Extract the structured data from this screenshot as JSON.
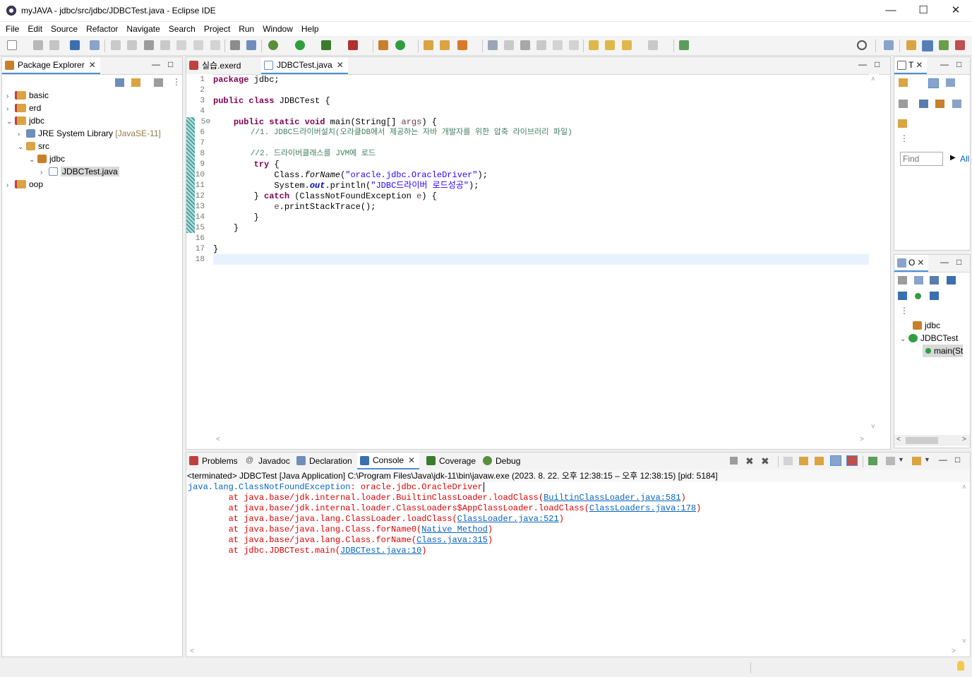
{
  "window": {
    "title": "myJAVA - jdbc/src/jdbc/JDBCTest.java - Eclipse IDE"
  },
  "menu": [
    "File",
    "Edit",
    "Source",
    "Refactor",
    "Navigate",
    "Search",
    "Project",
    "Run",
    "Window",
    "Help"
  ],
  "package_explorer": {
    "tab_label": "Package Explorer",
    "items": [
      {
        "label": "basic",
        "arrow": "›",
        "indent": 0
      },
      {
        "label": "erd",
        "arrow": "›",
        "indent": 0
      },
      {
        "label": "jdbc",
        "arrow": "⌄",
        "indent": 0
      },
      {
        "label": "JRE System Library",
        "suffix": "[JavaSE-11]",
        "arrow": "›",
        "indent": 1
      },
      {
        "label": "src",
        "arrow": "⌄",
        "indent": 1
      },
      {
        "label": "jdbc",
        "arrow": "⌄",
        "indent": 2
      },
      {
        "label": "JDBCTest.java",
        "arrow": "›",
        "indent": 3
      },
      {
        "label": "oop",
        "arrow": "›",
        "indent": 0
      }
    ]
  },
  "editor": {
    "tabs": [
      {
        "label": "실습.exerd",
        "active": false
      },
      {
        "label": "JDBCTest.java",
        "active": true
      }
    ],
    "line_numbers": [
      "1",
      "2",
      "3",
      "4",
      "5⊖",
      "6",
      "7",
      "8",
      "9",
      "10",
      "11",
      "12",
      "13",
      "14",
      "15",
      "16",
      "17",
      "18"
    ]
  },
  "code": {
    "l1_kw": "package",
    "l1_rest": " jdbc;",
    "l3_kw1": "public",
    "l3_kw2": "class",
    "l3_rest": " JDBCTest {",
    "l5_kw1": "public",
    "l5_kw2": "static",
    "l5_kw3": "void",
    "l5_rest": " main(String[] ",
    "l5_var": "args",
    "l5_end": ") {",
    "l6": "//1. JDBC드라이버설치(오라클DB에서 제공하는 자바 개발자를 위한 압축 라이브러리 파일)",
    "l8": "//2. 드라이버클래스를 JVM에 로드",
    "l9_kw": "try",
    "l9_rest": " {",
    "l10_a": "Class.",
    "l10_b": "forName",
    "l10_c": "(",
    "l10_str": "\"oracle.jdbc.OracleDriver\"",
    "l10_end": ");",
    "l11_a": "System.",
    "l11_b": "out",
    "l11_c": ".println(",
    "l11_str": "\"JDBC드라이버 로드성공\"",
    "l11_end": ");",
    "l12_a": "} ",
    "l12_kw": "catch",
    "l12_b": " (ClassNotFoundException ",
    "l12_var": "e",
    "l12_end": ") {",
    "l13_var": "e",
    "l13_rest": ".printStackTrace();",
    "l14": "}",
    "l15": "}",
    "l17": "}"
  },
  "task_panel": {
    "tab_label": "T",
    "find_placeholder": "Find",
    "all_label": "All"
  },
  "outline": {
    "tab_label": "O",
    "items": [
      {
        "label": "jdbc"
      },
      {
        "label": "JDBCTest"
      },
      {
        "label": "main(St"
      }
    ]
  },
  "bottom": {
    "tabs": [
      {
        "label": "Problems"
      },
      {
        "label": "Javadoc"
      },
      {
        "label": "Declaration"
      },
      {
        "label": "Console",
        "active": true
      },
      {
        "label": "Coverage"
      },
      {
        "label": "Debug"
      }
    ],
    "status": "<terminated> JDBCTest [Java Application] C:\\Program Files\\Java\\jdk-11\\bin\\javaw.exe  (2023. 8. 22. 오후 12:38:15 – 오후 12:38:15) [pid: 5184]",
    "exception_class": "java.lang.ClassNotFoundException",
    "exception_msg": ": oracle.jdbc.OracleDriver",
    "stack": [
      {
        "pre": "\tat java.base/jdk.internal.loader.BuiltinClassLoader.loadClass(",
        "link": "BuiltinClassLoader.java:581",
        "post": ")"
      },
      {
        "pre": "\tat java.base/jdk.internal.loader.ClassLoaders$AppClassLoader.loadClass(",
        "link": "ClassLoaders.java:178",
        "post": ")"
      },
      {
        "pre": "\tat java.base/java.lang.ClassLoader.loadClass(",
        "link": "ClassLoader.java:521",
        "post": ")"
      },
      {
        "pre": "\tat java.base/java.lang.Class.forName0(",
        "link": "Native Method",
        "post": ")"
      },
      {
        "pre": "\tat java.base/java.lang.Class.forName(",
        "link": "Class.java:315",
        "post": ")"
      },
      {
        "pre": "\tat jdbc.JDBCTest.main(",
        "link": "JDBCTest.java:10",
        "post": ")"
      }
    ]
  },
  "colors": {
    "keyword": "#7f0055",
    "comment": "#3f7f5f",
    "string": "#2a00ff",
    "error": "#e00000",
    "link": "#0563c1",
    "tab_accent": "#4a90d9"
  }
}
